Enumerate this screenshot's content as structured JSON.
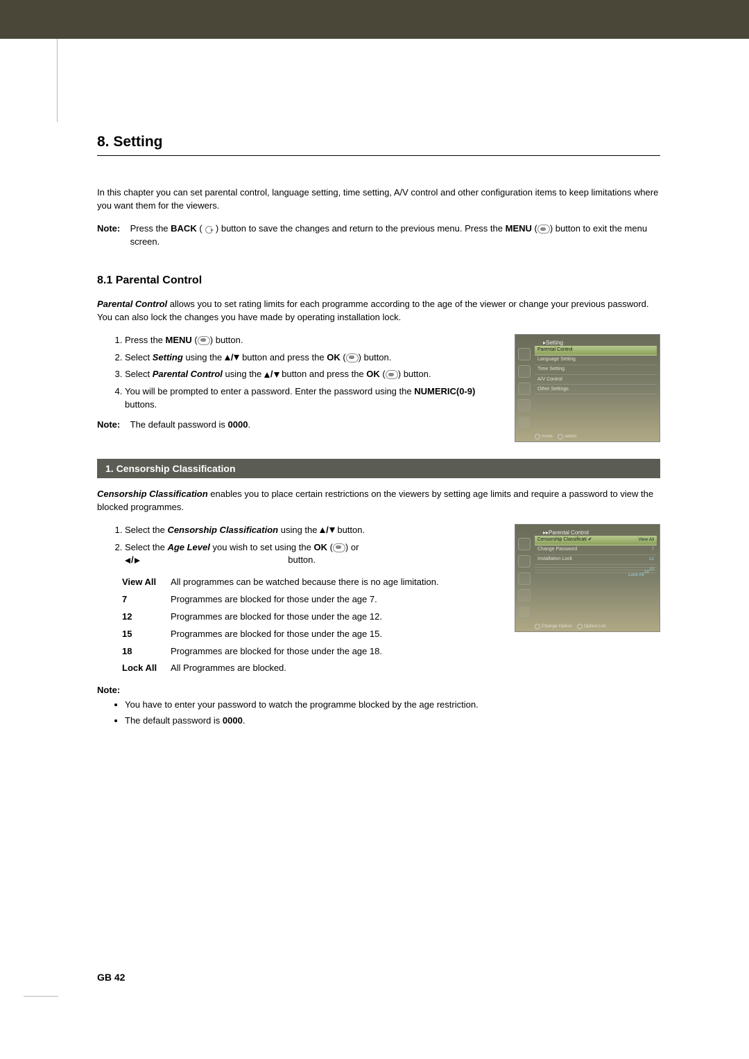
{
  "heading": "8. Setting",
  "intro": "In this chapter you can set parental control, language setting, time setting, A/V control and other configuration items to keep limitations where you want them for the viewers.",
  "note1": {
    "label": "Note:",
    "pre": "Press the ",
    "back": "BACK",
    "mid": " button to save the changes and return to the previous menu. Press the ",
    "menu": "MENU",
    "post": " button to exit the menu screen."
  },
  "section81": {
    "title": "8.1 Parental Control",
    "desc_pre": "Parental Control",
    "desc_post": " allows you to set rating limits for each programme according to the age of the viewer or change your previous password. You can also lock the changes you have made by operating installation lock.",
    "steps": {
      "s1_a": "Press the ",
      "s1_b": "MENU",
      "s1_c": " button.",
      "s2_a": "Select ",
      "s2_b": "Setting",
      "s2_c": " using the ",
      "s2_d": " button and press the ",
      "s2_e": "OK",
      "s2_f": " button.",
      "s3_a": "Select ",
      "s3_b": "Parental Control",
      "s3_c": " using the ",
      "s3_d": " button and press the ",
      "s3_e": "OK",
      "s3_f": " button.",
      "s4_a": "You will be prompted to enter a password. Enter the password using the ",
      "s4_b": "NUMERIC(0-9)",
      "s4_c": " buttons."
    },
    "note2": {
      "label": "Note:",
      "pre": "The default password is ",
      "val": "0000",
      "post": "."
    }
  },
  "sub1": {
    "bar": "1. Censorship Classification",
    "desc_pre": "Censorship Classification",
    "desc_post": " enables you to place certain restrictions on the viewers by setting age limits and require a password to view the blocked programmes.",
    "step1_a": "Select the ",
    "step1_b": "Censorship Classification",
    "step1_c": " using the ",
    "step1_d": " button.",
    "step2_a": "Select the ",
    "step2_b": "Age Level",
    "step2_c": " you wish to set using the ",
    "step2_d": "OK",
    "step2_e": " or ",
    "step2_f": " button.",
    "rows": {
      "k0": "View All",
      "v0": "All programmes can be watched because there is no age limitation.",
      "k1": "7",
      "v1": "Programmes are blocked for those under the age 7.",
      "k2": "12",
      "v2": "Programmes are blocked for those under the age 12.",
      "k3": "15",
      "v3": "Programmes are blocked for those under the age 15.",
      "k4": "18",
      "v4": "Programmes are blocked for those under the age 18.",
      "k5": "Lock All",
      "v5": "All Programmes are blocked."
    },
    "note3": {
      "label": "Note:",
      "b1": "You have to enter your password to watch the programme blocked by the age restriction.",
      "b2_a": "The default password is ",
      "b2_b": "0000",
      "b2_c": "."
    }
  },
  "mock1": {
    "title": "▸Setting",
    "items": [
      "Parental Control",
      "Language Setting",
      "Time Setting",
      "A/V Control",
      "Other Settings"
    ],
    "foot1": "move",
    "foot2": "select"
  },
  "mock2": {
    "title": "▸▸Parental Control",
    "rows": [
      {
        "name": "Censorship Classificati",
        "val": "View All",
        "sel": true,
        "check": "✔"
      },
      {
        "name": "Change Password",
        "val": "7"
      },
      {
        "name": "Installation Lock",
        "val": "12"
      },
      {
        "name": "",
        "val": "15"
      },
      {
        "name": "",
        "val": "18"
      },
      {
        "name": "",
        "val": "Lock All"
      }
    ],
    "foot1": "Change Option",
    "foot2": "Option List"
  },
  "page_footer": "GB 42"
}
